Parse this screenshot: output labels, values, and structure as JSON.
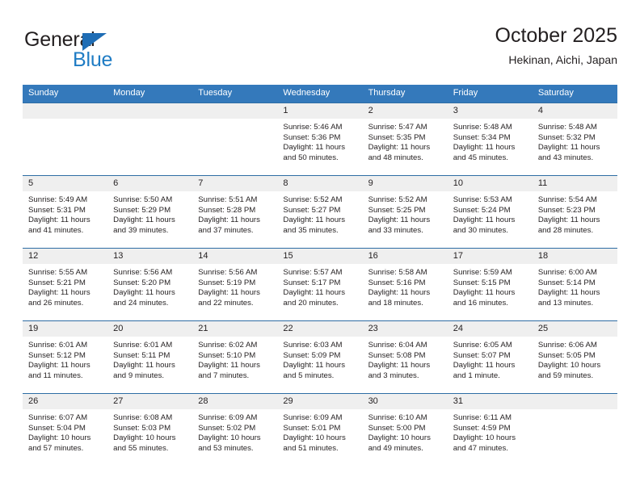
{
  "brand": {
    "name_top": "General",
    "name_bottom": "Blue",
    "triangle_color": "#1f6db5",
    "text_color": "#231f20",
    "blue_color": "#1f7cc4"
  },
  "header": {
    "title": "October 2025",
    "subtitle": "Hekinan, Aichi, Japan"
  },
  "theme": {
    "header_bg": "#3479bb",
    "row_divider": "#2e6da4",
    "daynum_band_bg": "#efefef",
    "text": "#231f20"
  },
  "labels": {
    "sunrise_prefix": "Sunrise:",
    "sunset_prefix": "Sunset:",
    "daylight_prefix": "Daylight:"
  },
  "weekdays": [
    "Sunday",
    "Monday",
    "Tuesday",
    "Wednesday",
    "Thursday",
    "Friday",
    "Saturday"
  ],
  "weeks": [
    [
      {
        "day": "",
        "sunrise": "",
        "sunset": "",
        "daylight_1": "",
        "daylight_2": ""
      },
      {
        "day": "",
        "sunrise": "",
        "sunset": "",
        "daylight_1": "",
        "daylight_2": ""
      },
      {
        "day": "",
        "sunrise": "",
        "sunset": "",
        "daylight_1": "",
        "daylight_2": ""
      },
      {
        "day": "1",
        "sunrise": "Sunrise: 5:46 AM",
        "sunset": "Sunset: 5:36 PM",
        "daylight_1": "Daylight: 11 hours",
        "daylight_2": "and 50 minutes."
      },
      {
        "day": "2",
        "sunrise": "Sunrise: 5:47 AM",
        "sunset": "Sunset: 5:35 PM",
        "daylight_1": "Daylight: 11 hours",
        "daylight_2": "and 48 minutes."
      },
      {
        "day": "3",
        "sunrise": "Sunrise: 5:48 AM",
        "sunset": "Sunset: 5:34 PM",
        "daylight_1": "Daylight: 11 hours",
        "daylight_2": "and 45 minutes."
      },
      {
        "day": "4",
        "sunrise": "Sunrise: 5:48 AM",
        "sunset": "Sunset: 5:32 PM",
        "daylight_1": "Daylight: 11 hours",
        "daylight_2": "and 43 minutes."
      }
    ],
    [
      {
        "day": "5",
        "sunrise": "Sunrise: 5:49 AM",
        "sunset": "Sunset: 5:31 PM",
        "daylight_1": "Daylight: 11 hours",
        "daylight_2": "and 41 minutes."
      },
      {
        "day": "6",
        "sunrise": "Sunrise: 5:50 AM",
        "sunset": "Sunset: 5:29 PM",
        "daylight_1": "Daylight: 11 hours",
        "daylight_2": "and 39 minutes."
      },
      {
        "day": "7",
        "sunrise": "Sunrise: 5:51 AM",
        "sunset": "Sunset: 5:28 PM",
        "daylight_1": "Daylight: 11 hours",
        "daylight_2": "and 37 minutes."
      },
      {
        "day": "8",
        "sunrise": "Sunrise: 5:52 AM",
        "sunset": "Sunset: 5:27 PM",
        "daylight_1": "Daylight: 11 hours",
        "daylight_2": "and 35 minutes."
      },
      {
        "day": "9",
        "sunrise": "Sunrise: 5:52 AM",
        "sunset": "Sunset: 5:25 PM",
        "daylight_1": "Daylight: 11 hours",
        "daylight_2": "and 33 minutes."
      },
      {
        "day": "10",
        "sunrise": "Sunrise: 5:53 AM",
        "sunset": "Sunset: 5:24 PM",
        "daylight_1": "Daylight: 11 hours",
        "daylight_2": "and 30 minutes."
      },
      {
        "day": "11",
        "sunrise": "Sunrise: 5:54 AM",
        "sunset": "Sunset: 5:23 PM",
        "daylight_1": "Daylight: 11 hours",
        "daylight_2": "and 28 minutes."
      }
    ],
    [
      {
        "day": "12",
        "sunrise": "Sunrise: 5:55 AM",
        "sunset": "Sunset: 5:21 PM",
        "daylight_1": "Daylight: 11 hours",
        "daylight_2": "and 26 minutes."
      },
      {
        "day": "13",
        "sunrise": "Sunrise: 5:56 AM",
        "sunset": "Sunset: 5:20 PM",
        "daylight_1": "Daylight: 11 hours",
        "daylight_2": "and 24 minutes."
      },
      {
        "day": "14",
        "sunrise": "Sunrise: 5:56 AM",
        "sunset": "Sunset: 5:19 PM",
        "daylight_1": "Daylight: 11 hours",
        "daylight_2": "and 22 minutes."
      },
      {
        "day": "15",
        "sunrise": "Sunrise: 5:57 AM",
        "sunset": "Sunset: 5:17 PM",
        "daylight_1": "Daylight: 11 hours",
        "daylight_2": "and 20 minutes."
      },
      {
        "day": "16",
        "sunrise": "Sunrise: 5:58 AM",
        "sunset": "Sunset: 5:16 PM",
        "daylight_1": "Daylight: 11 hours",
        "daylight_2": "and 18 minutes."
      },
      {
        "day": "17",
        "sunrise": "Sunrise: 5:59 AM",
        "sunset": "Sunset: 5:15 PM",
        "daylight_1": "Daylight: 11 hours",
        "daylight_2": "and 16 minutes."
      },
      {
        "day": "18",
        "sunrise": "Sunrise: 6:00 AM",
        "sunset": "Sunset: 5:14 PM",
        "daylight_1": "Daylight: 11 hours",
        "daylight_2": "and 13 minutes."
      }
    ],
    [
      {
        "day": "19",
        "sunrise": "Sunrise: 6:01 AM",
        "sunset": "Sunset: 5:12 PM",
        "daylight_1": "Daylight: 11 hours",
        "daylight_2": "and 11 minutes."
      },
      {
        "day": "20",
        "sunrise": "Sunrise: 6:01 AM",
        "sunset": "Sunset: 5:11 PM",
        "daylight_1": "Daylight: 11 hours",
        "daylight_2": "and 9 minutes."
      },
      {
        "day": "21",
        "sunrise": "Sunrise: 6:02 AM",
        "sunset": "Sunset: 5:10 PM",
        "daylight_1": "Daylight: 11 hours",
        "daylight_2": "and 7 minutes."
      },
      {
        "day": "22",
        "sunrise": "Sunrise: 6:03 AM",
        "sunset": "Sunset: 5:09 PM",
        "daylight_1": "Daylight: 11 hours",
        "daylight_2": "and 5 minutes."
      },
      {
        "day": "23",
        "sunrise": "Sunrise: 6:04 AM",
        "sunset": "Sunset: 5:08 PM",
        "daylight_1": "Daylight: 11 hours",
        "daylight_2": "and 3 minutes."
      },
      {
        "day": "24",
        "sunrise": "Sunrise: 6:05 AM",
        "sunset": "Sunset: 5:07 PM",
        "daylight_1": "Daylight: 11 hours",
        "daylight_2": "and 1 minute."
      },
      {
        "day": "25",
        "sunrise": "Sunrise: 6:06 AM",
        "sunset": "Sunset: 5:05 PM",
        "daylight_1": "Daylight: 10 hours",
        "daylight_2": "and 59 minutes."
      }
    ],
    [
      {
        "day": "26",
        "sunrise": "Sunrise: 6:07 AM",
        "sunset": "Sunset: 5:04 PM",
        "daylight_1": "Daylight: 10 hours",
        "daylight_2": "and 57 minutes."
      },
      {
        "day": "27",
        "sunrise": "Sunrise: 6:08 AM",
        "sunset": "Sunset: 5:03 PM",
        "daylight_1": "Daylight: 10 hours",
        "daylight_2": "and 55 minutes."
      },
      {
        "day": "28",
        "sunrise": "Sunrise: 6:09 AM",
        "sunset": "Sunset: 5:02 PM",
        "daylight_1": "Daylight: 10 hours",
        "daylight_2": "and 53 minutes."
      },
      {
        "day": "29",
        "sunrise": "Sunrise: 6:09 AM",
        "sunset": "Sunset: 5:01 PM",
        "daylight_1": "Daylight: 10 hours",
        "daylight_2": "and 51 minutes."
      },
      {
        "day": "30",
        "sunrise": "Sunrise: 6:10 AM",
        "sunset": "Sunset: 5:00 PM",
        "daylight_1": "Daylight: 10 hours",
        "daylight_2": "and 49 minutes."
      },
      {
        "day": "31",
        "sunrise": "Sunrise: 6:11 AM",
        "sunset": "Sunset: 4:59 PM",
        "daylight_1": "Daylight: 10 hours",
        "daylight_2": "and 47 minutes."
      },
      {
        "day": "",
        "sunrise": "",
        "sunset": "",
        "daylight_1": "",
        "daylight_2": ""
      }
    ]
  ]
}
